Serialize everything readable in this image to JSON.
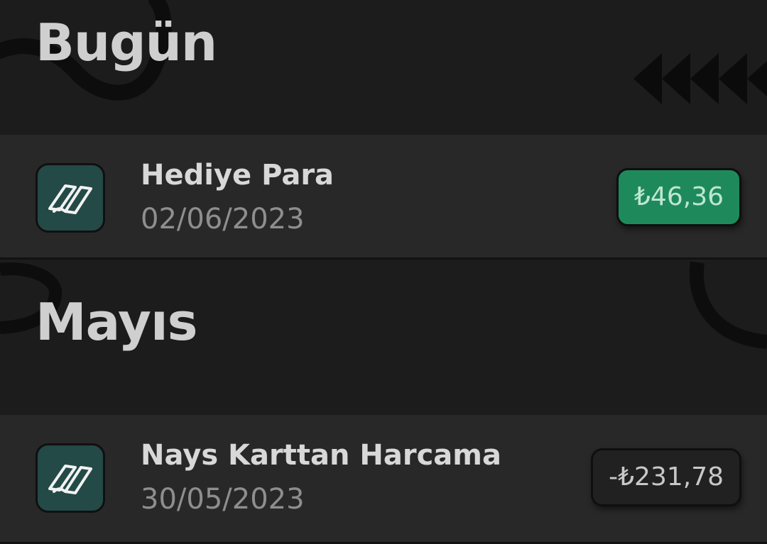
{
  "sections": [
    {
      "title": "Bugün",
      "transactions": [
        {
          "title": "Hediye Para",
          "date": "02/06/2023",
          "amount": "₺46,36",
          "type": "income",
          "icon": "papara-logo-icon"
        }
      ]
    },
    {
      "title": "Mayıs",
      "transactions": [
        {
          "title": "Nays Karttan Harcama",
          "date": "30/05/2023",
          "amount": "-₺231,78",
          "type": "expense",
          "icon": "papara-logo-icon"
        }
      ]
    }
  ],
  "colors": {
    "background": "#1c1c1c",
    "row_background": "#282828",
    "icon_background": "#234a47",
    "income_badge": "#1e8a5c",
    "expense_badge": "#212121",
    "title_text": "#cfcfcf",
    "date_text": "#8e8e8e"
  }
}
